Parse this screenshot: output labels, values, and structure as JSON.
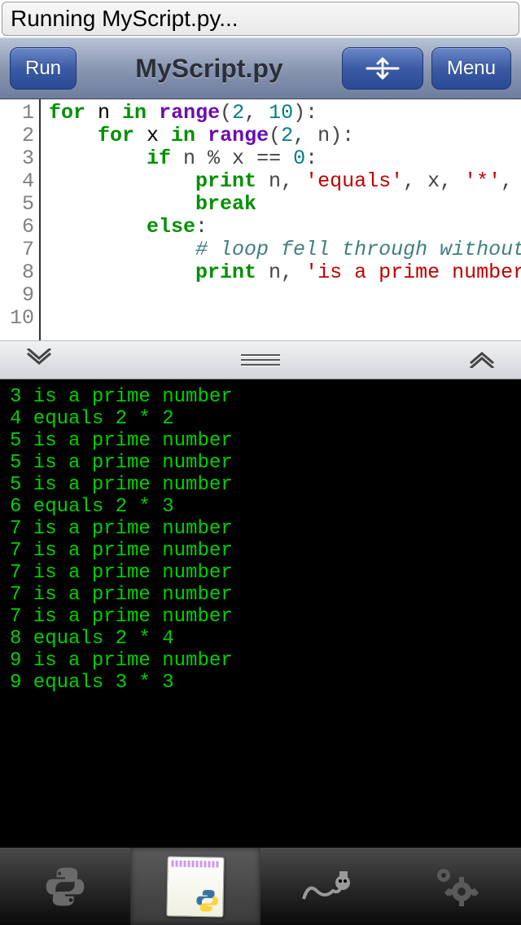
{
  "status_text": "Running MyScript.py...",
  "header": {
    "run_label": "Run",
    "title": "MyScript.py",
    "menu_label": "Menu"
  },
  "editor": {
    "line_numbers": [
      "1",
      "2",
      "3",
      "4",
      "5",
      "6",
      "7",
      "8",
      "9",
      "10"
    ],
    "lines": [
      [
        {
          "t": "for",
          "c": "kw"
        },
        {
          "t": " n ",
          "c": ""
        },
        {
          "t": "in",
          "c": "kw"
        },
        {
          "t": " ",
          "c": ""
        },
        {
          "t": "range",
          "c": "builtin"
        },
        {
          "t": "(",
          "c": "op"
        },
        {
          "t": "2",
          "c": "num"
        },
        {
          "t": ", ",
          "c": "op"
        },
        {
          "t": "10",
          "c": "num"
        },
        {
          "t": "):",
          "c": "op"
        }
      ],
      [
        {
          "t": "    ",
          "c": ""
        },
        {
          "t": "for",
          "c": "kw"
        },
        {
          "t": " x ",
          "c": ""
        },
        {
          "t": "in",
          "c": "kw"
        },
        {
          "t": " ",
          "c": ""
        },
        {
          "t": "range",
          "c": "builtin"
        },
        {
          "t": "(",
          "c": "op"
        },
        {
          "t": "2",
          "c": "num"
        },
        {
          "t": ", n):",
          "c": "op"
        }
      ],
      [
        {
          "t": "        ",
          "c": ""
        },
        {
          "t": "if",
          "c": "kw"
        },
        {
          "t": " n % x == ",
          "c": "op"
        },
        {
          "t": "0",
          "c": "num"
        },
        {
          "t": ":",
          "c": "op"
        }
      ],
      [
        {
          "t": "            ",
          "c": ""
        },
        {
          "t": "print",
          "c": "kw"
        },
        {
          "t": " n, ",
          "c": "op"
        },
        {
          "t": "'equals'",
          "c": "str"
        },
        {
          "t": ", x, ",
          "c": "op"
        },
        {
          "t": "'*'",
          "c": "str"
        },
        {
          "t": ", n",
          "c": "op"
        }
      ],
      [
        {
          "t": "            ",
          "c": ""
        },
        {
          "t": "break",
          "c": "kw"
        }
      ],
      [
        {
          "t": "        ",
          "c": ""
        },
        {
          "t": "else",
          "c": "kw"
        },
        {
          "t": ":",
          "c": "op"
        }
      ],
      [
        {
          "t": "            ",
          "c": ""
        },
        {
          "t": "# loop fell through without ",
          "c": "cm"
        }
      ],
      [
        {
          "t": "            ",
          "c": ""
        },
        {
          "t": "print",
          "c": "kw"
        },
        {
          "t": " n, ",
          "c": "op"
        },
        {
          "t": "'is a prime number'",
          "c": "str"
        }
      ],
      [],
      []
    ]
  },
  "console_lines": [
    "3 is a prime number",
    "4 equals 2 * 2",
    "5 is a prime number",
    "5 is a prime number",
    "5 is a prime number",
    "6 equals 2 * 3",
    "7 is a prime number",
    "7 is a prime number",
    "7 is a prime number",
    "7 is a prime number",
    "7 is a prime number",
    "8 equals 2 * 4",
    "9 is a prime number",
    "9 equals 3 * 3"
  ],
  "tabs": {
    "items": [
      "python-icon",
      "script-doc",
      "snake-icon",
      "gear-icon"
    ],
    "active_index": 1
  }
}
